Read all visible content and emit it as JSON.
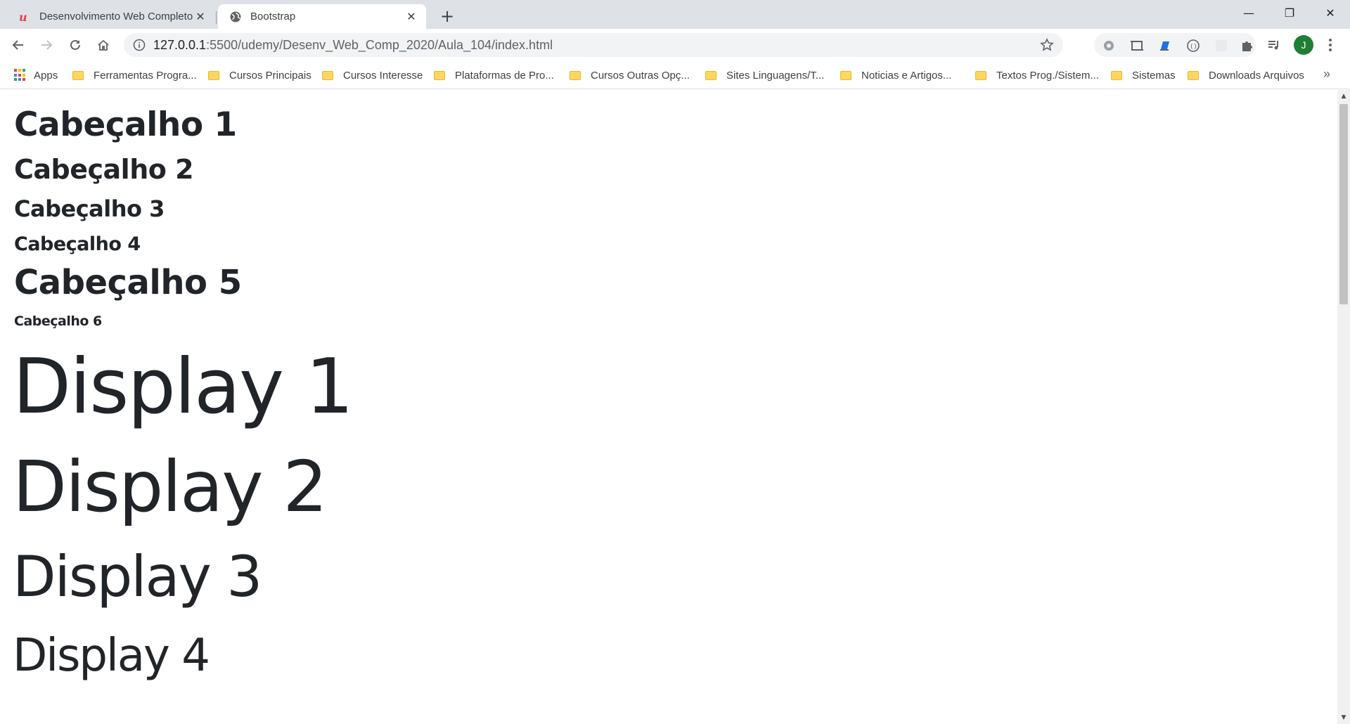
{
  "browser": {
    "tabs": [
      {
        "title": "Desenvolvimento Web Completo",
        "favicon": "udemy-icon",
        "active": false
      },
      {
        "title": "Bootstrap",
        "favicon": "globe-icon",
        "active": true
      }
    ],
    "new_tab_symbol": "+",
    "window_controls": {
      "minimize": "—",
      "restore": "❐",
      "close": "✕"
    },
    "url_host": "127.0.0.1",
    "url_path": ":5500/udemy/Desenv_Web_Comp_2020/Aula_104/index.html",
    "profile_initial": "J",
    "profile_color": "#1e7e34"
  },
  "bookmarks": {
    "apps_label": "Apps",
    "items": [
      "Ferramentas Progra...",
      "Cursos Principais",
      "Cursos Interesse",
      "Plataformas de Pro...",
      "Cursos Outras Opç...",
      "Sites Linguagens/T...",
      "Noticias e Artigos...",
      "Textos Prog./Sistem...",
      "Sistemas",
      "Downloads Arquivos"
    ],
    "more": "»"
  },
  "page": {
    "headings": {
      "h1": "Cabeçalho 1",
      "h2": "Cabeçalho 2",
      "h3": "Cabeçalho 3",
      "h4": "Cabeçalho 4",
      "h5": "Cabeçalho 5",
      "h6": "Cabeçalho 6"
    },
    "displays": {
      "d1": "Display 1",
      "d2": "Display 2",
      "d3": "Display 3",
      "d4": "Display 4"
    },
    "text_color": "#212529"
  }
}
